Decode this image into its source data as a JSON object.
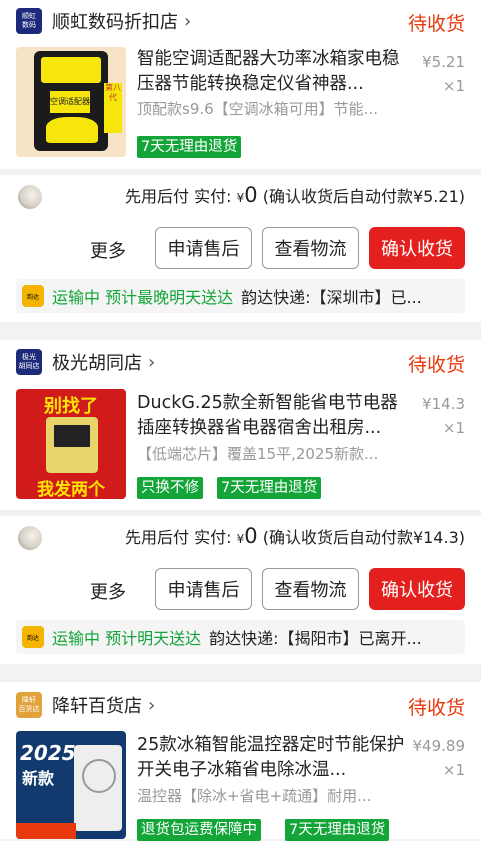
{
  "orders": [
    {
      "shop_logo": "顺虹\n数码",
      "shop_name": "顺虹数码折扣店",
      "status": "待收货",
      "title": "智能空调适配器大功率冰箱家电稳压器节能转换稳定仪省神器...",
      "price": "¥5.21",
      "qty": "×1",
      "sku": "顶配款s9.6【空调冰箱可用】节能...",
      "tags": [
        "7天无理由退货"
      ],
      "pay_label": "先用后付 实付:",
      "pay_currency": "¥",
      "pay_amount": "0",
      "pay_note": "(确认收货后自动付款¥5.21)",
      "more_label": "更多",
      "buttons": [
        "申请售后",
        "查看物流",
        "确认收货"
      ],
      "logistics_icon": "韵达",
      "logistics_status": "运输中 预计最晚明天送达",
      "logistics_detail": "韵达快递:【深圳市】已..."
    },
    {
      "shop_logo": "极光\n胡同店",
      "shop_name": "极光胡同店",
      "status": "待收货",
      "title": "DuckG.25款全新智能省电节电器插座转换器省电器宿舍出租房...",
      "price": "¥14.3",
      "qty": "×1",
      "sku": "【低端芯片】覆盖15平,2025新款...",
      "tags": [
        "只换不修",
        "7天无理由退货"
      ],
      "pay_label": "先用后付 实付:",
      "pay_currency": "¥",
      "pay_amount": "0",
      "pay_note": "(确认收货后自动付款¥14.3)",
      "more_label": "更多",
      "buttons": [
        "申请售后",
        "查看物流",
        "确认收货"
      ],
      "logistics_icon": "韵达",
      "logistics_status": "运输中 预计明天送达",
      "logistics_detail": "韵达快递:【揭阳市】已离开..."
    },
    {
      "shop_logo": "降轩\n百货店",
      "shop_name": "降轩百货店",
      "status": "待收货",
      "title": "25款冰箱智能温控器定时节能保护开关电子冰箱省电除冰温...",
      "price": "¥49.89",
      "qty": "×1",
      "sku": "温控器【除冰+省电+疏通】耐用...",
      "tags": [
        "退货包运费保障中",
        "7天无理由退货"
      ]
    }
  ],
  "thumb_text": {
    "o1_lines": [
      "空调适配器",
      "第八代"
    ],
    "o2_top": "别找了",
    "o2_bottom": "我发两个",
    "o3_top": "2025",
    "o3_sub": "新款"
  },
  "colors": {
    "accent_red": "#e4201f",
    "status_orange": "#e8380d",
    "tag_green": "#13a538",
    "logistics_green": "#13a538"
  }
}
